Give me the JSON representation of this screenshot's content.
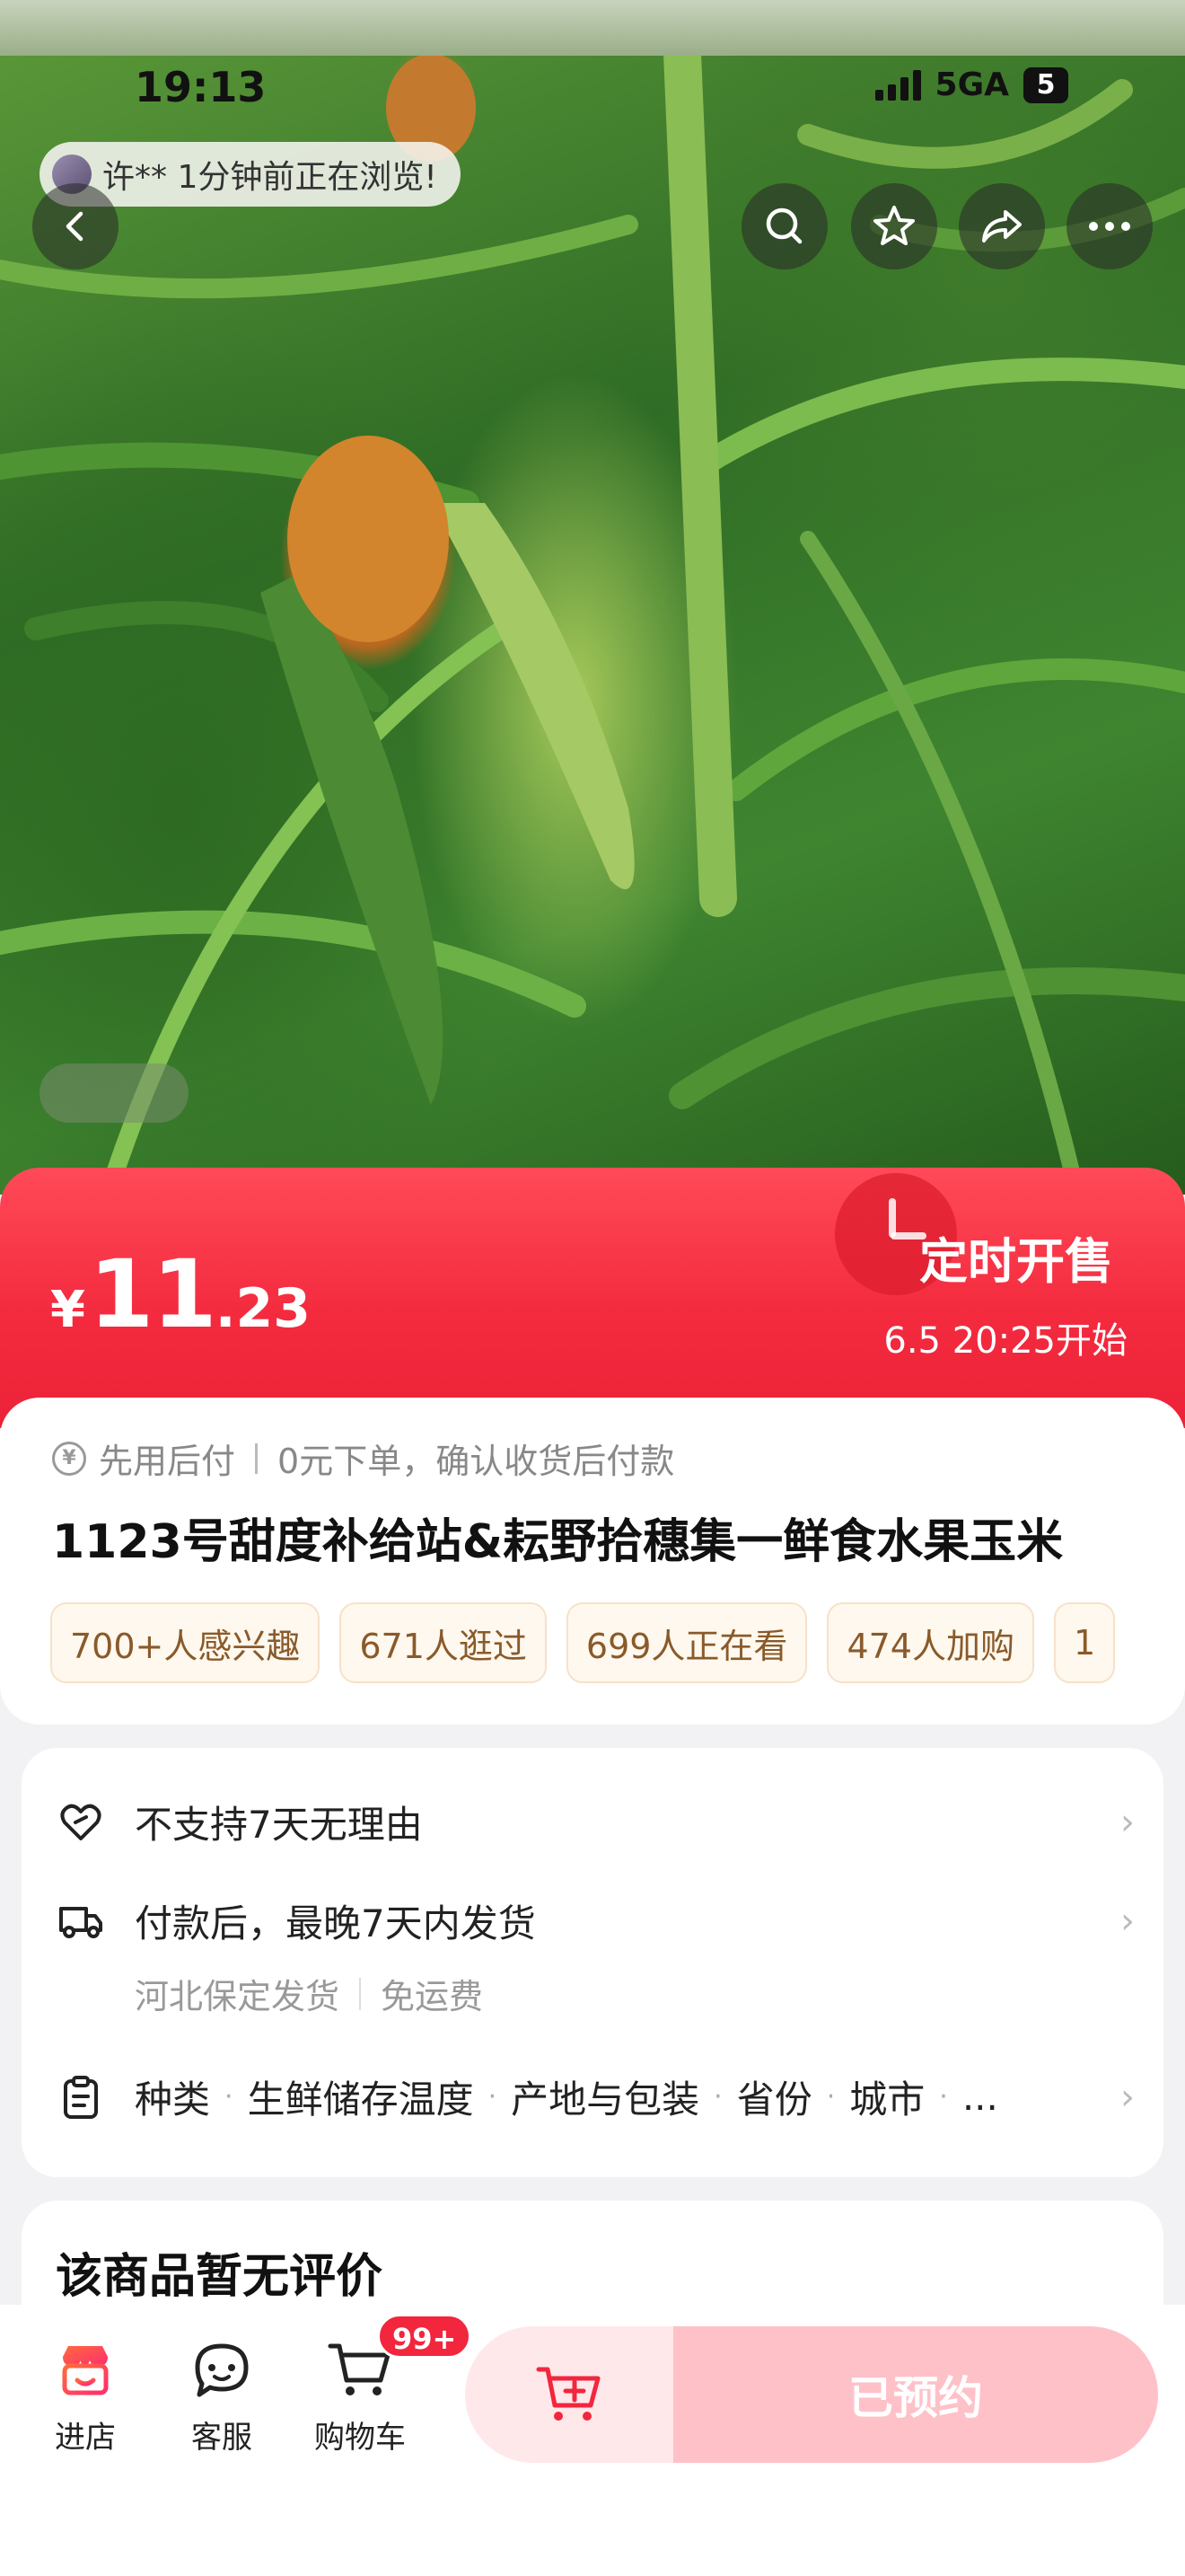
{
  "status_bar": {
    "time": "19:13",
    "network": "5GA",
    "battery": "5"
  },
  "browsing": {
    "text": "许** 1分钟前正在浏览!"
  },
  "price_banner": {
    "currency": "¥",
    "price_int": "11",
    "price_dec": ".23",
    "sale_title": "定时开售",
    "sale_time": "6.5 20:25开始"
  },
  "info": {
    "paylater_icon": "¥",
    "paylater_left": "先用后付",
    "paylater_right": "0元下单，确认收货后付款",
    "title": "1123号甜度补给站&耘野拾穗集一鲜食水果玉米",
    "tags": [
      "700+人感兴趣",
      "671人逛过",
      "699人正在看",
      "474人加购",
      "1"
    ]
  },
  "service": {
    "return_policy": "不支持7天无理由",
    "shipping": "付款后，最晚7天内发货",
    "ship_from": "河北保定发货",
    "ship_fee": "免运费",
    "attributes": [
      "种类",
      "生鲜储存温度",
      "产地与包装",
      "省份",
      "城市",
      "..."
    ],
    "chevron": "›"
  },
  "review": {
    "title": "该商品暂无评价"
  },
  "bottom_bar": {
    "shop_label": "进店",
    "service_label": "客服",
    "cart_label": "购物车",
    "cart_badge": "99+",
    "reserved_label": "已预约"
  },
  "colors": {
    "accent_red": "#f42b3f",
    "tag_text": "#8a5a2a",
    "reserved_bg": "#ffc1c8"
  }
}
